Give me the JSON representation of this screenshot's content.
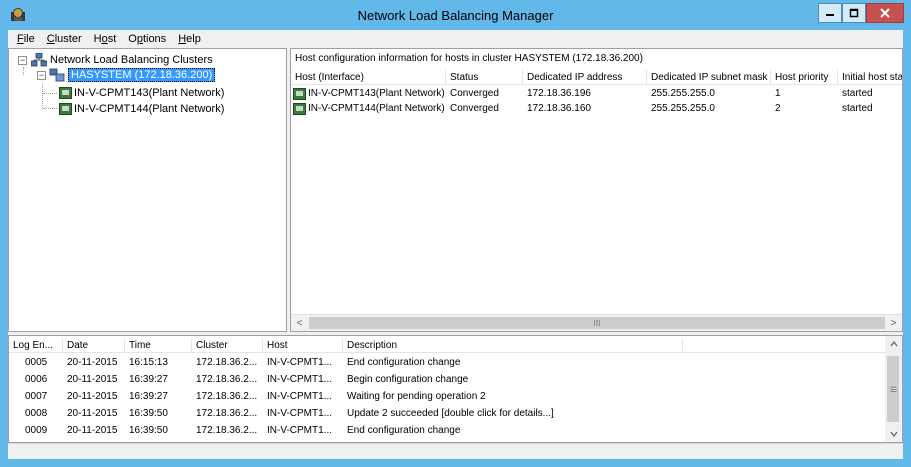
{
  "window": {
    "title": "Network Load Balancing Manager",
    "accent": "#62b9e9",
    "close_color": "#c75050"
  },
  "menu": [
    {
      "mnemonic": "F",
      "rest": "ile"
    },
    {
      "mnemonic": "C",
      "rest": "luster"
    },
    {
      "pre": "H",
      "mnemonic": "o",
      "rest": "st"
    },
    {
      "mnemonic": "O",
      "rest": "ptions",
      "pre_u": "O"
    },
    {
      "mnemonic": "H",
      "rest": "elp"
    }
  ],
  "menu_labels": {
    "file_u": "F",
    "file_rest": "ile",
    "cluster_u": "C",
    "cluster_rest": "luster",
    "host_pre": "H",
    "host_u": "o",
    "host_rest": "st",
    "options_pre": "O",
    "options_u": "p",
    "options_rest": "tions",
    "help_u": "H",
    "help_rest": "elp"
  },
  "tree": {
    "root": "Network Load Balancing Clusters",
    "cluster": "HASYSTEM (172.18.36.200)",
    "hosts": [
      "IN-V-CPMT143(Plant Network)",
      "IN-V-CPMT144(Plant Network)"
    ]
  },
  "hosts_pane": {
    "heading": "Host configuration information for hosts in cluster HASYSTEM (172.18.36.200)",
    "columns": [
      "Host (Interface)",
      "Status",
      "Dedicated IP address",
      "Dedicated IP subnet mask",
      "Host priority",
      "Initial host state"
    ],
    "rows": [
      [
        "IN-V-CPMT143(Plant Network)",
        "Converged",
        "172.18.36.196",
        "255.255.255.0",
        "1",
        "started"
      ],
      [
        "IN-V-CPMT144(Plant Network)",
        "Converged",
        "172.18.36.160",
        "255.255.255.0",
        "2",
        "started"
      ]
    ]
  },
  "log_pane": {
    "columns": [
      "Log En...",
      "Date",
      "Time",
      "Cluster",
      "Host",
      "Description"
    ],
    "rows": [
      [
        "0005",
        "20-11-2015",
        "16:15:13",
        "172.18.36.2...",
        "IN-V-CPMT1...",
        "End configuration change"
      ],
      [
        "0006",
        "20-11-2015",
        "16:39:27",
        "172.18.36.2...",
        "IN-V-CPMT1...",
        "Begin configuration change"
      ],
      [
        "0007",
        "20-11-2015",
        "16:39:27",
        "172.18.36.2...",
        "IN-V-CPMT1...",
        "Waiting for pending operation 2"
      ],
      [
        "0008",
        "20-11-2015",
        "16:39:50",
        "172.18.36.2...",
        "IN-V-CPMT1...",
        "Update 2 succeeded [double click for details...]"
      ],
      [
        "0009",
        "20-11-2015",
        "16:39:50",
        "172.18.36.2...",
        "IN-V-CPMT1...",
        "End configuration change"
      ]
    ]
  },
  "scroll": {
    "thumb_grip": "III",
    "left_arrow": "<",
    "right_arrow": ">",
    "up_arrow": "^",
    "down_arrow": "v"
  }
}
